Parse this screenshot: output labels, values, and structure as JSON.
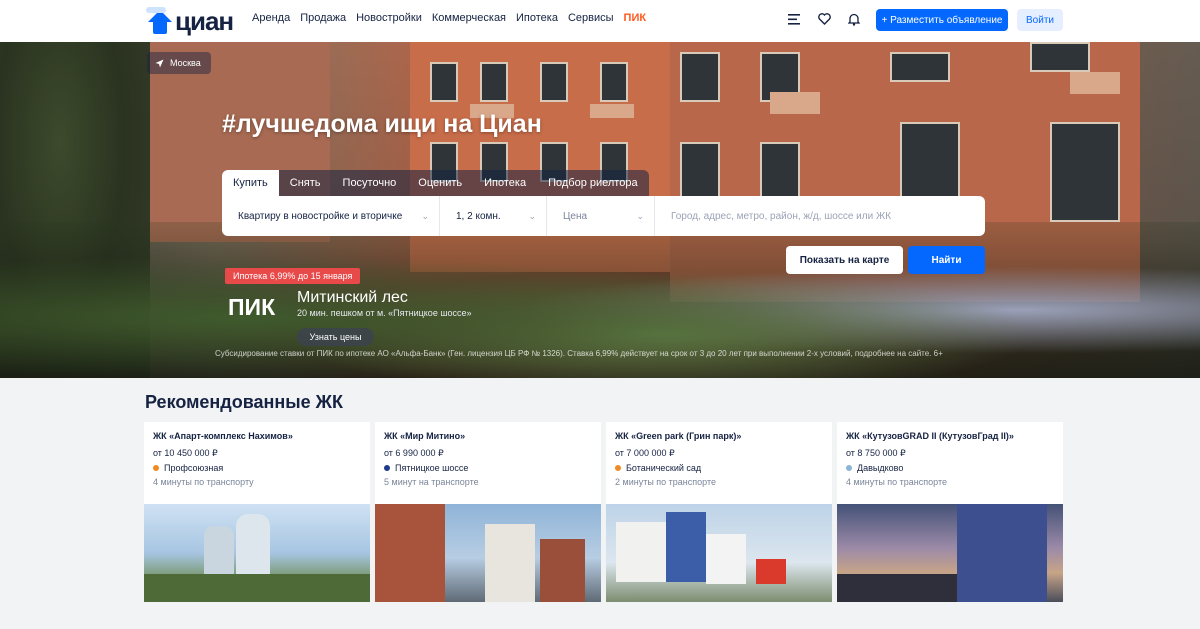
{
  "header": {
    "logo_text": "циан",
    "nav": [
      {
        "label": "Аренда"
      },
      {
        "label": "Продажа"
      },
      {
        "label": "Новостройки"
      },
      {
        "label": "Коммерческая"
      },
      {
        "label": "Ипотека"
      },
      {
        "label": "Сервисы"
      },
      {
        "label": "ПИК"
      }
    ],
    "icons": [
      "menu-icon",
      "heart-icon",
      "bell-icon"
    ],
    "place_ad_label": "+ Разместить объявление",
    "login_label": "Войти"
  },
  "hero": {
    "location": "Москва",
    "title": "#лучшедома ищи на Циан",
    "tabs": [
      {
        "label": "Купить",
        "active": true
      },
      {
        "label": "Снять",
        "active": false
      },
      {
        "label": "Посуточно",
        "active": false
      },
      {
        "label": "Оценить",
        "active": false
      },
      {
        "label": "Ипотека",
        "active": false
      },
      {
        "label": "Подбор риелтора",
        "active": false
      }
    ],
    "search": {
      "property_type": "Квартиру в новостройке и вторичке",
      "rooms": "1, 2 комн.",
      "price_placeholder": "Цена",
      "query_placeholder": "Город, адрес, метро, район, ж/д, шоссе или ЖК"
    },
    "show_on_map_label": "Показать на карте",
    "find_label": "Найти",
    "promo": {
      "badge": "Ипотека 6,99% до 15 января",
      "brand": "ПИК",
      "title": "Митинский лес",
      "subtitle": "20 мин. пешком от м. «Пятницкое шоссе»",
      "button": "Узнать цены",
      "disclaimer": "Субсидирование ставки от ПИК по ипотеке АО «Альфа-Банк» (Ген. лицензия ЦБ РФ № 1326). Ставка 6,99% действует на срок от 3 до 20 лет при выполнении 2-х условий, подробнее на сайте. 6+"
    }
  },
  "recommended": {
    "title": "Рекомендованные ЖК",
    "cards": [
      {
        "name": "ЖК «Апарт-комплекс Нахимов»",
        "price": "от 10 450 000 ₽",
        "metro": "Профсоюзная",
        "metro_color": "#f08a24",
        "time": "4 минуты по транспорту"
      },
      {
        "name": "ЖК «Мир Митино»",
        "price": "от 6 990 000 ₽",
        "metro": "Пятницкое шоссе",
        "metro_color": "#1f3a8a",
        "time": "5 минут на транспорте"
      },
      {
        "name": "ЖК «Green park (Грин парк)»",
        "price": "от 7 000 000 ₽",
        "metro": "Ботанический сад",
        "metro_color": "#f08a24",
        "time": "2 минуты по транспорте"
      },
      {
        "name": "ЖК «КутузовGRAD II (КутузовГрад II)»",
        "price": "от 8 750 000 ₽",
        "metro": "Давыдково",
        "metro_color": "#8ab4d8",
        "time": "4 минуты по транспорте"
      }
    ]
  }
}
